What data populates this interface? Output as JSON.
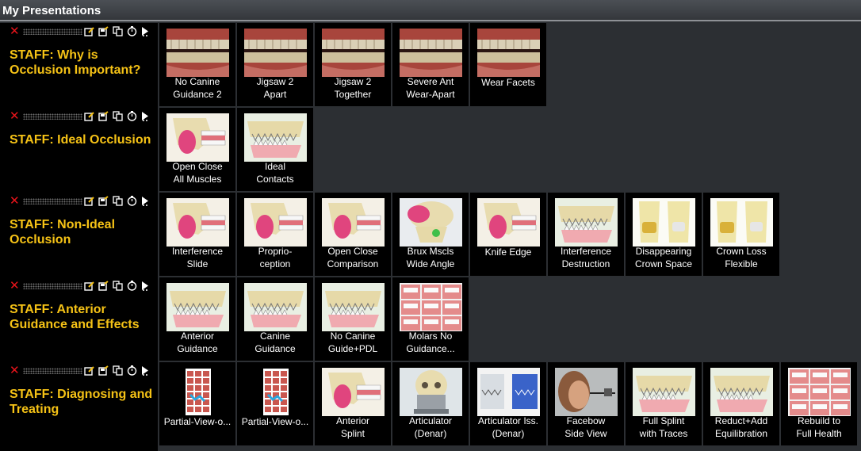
{
  "header": {
    "title": "My Presentations"
  },
  "rows": [
    {
      "title": "STAFF: Why is Occlusion Important?",
      "items": [
        {
          "label": "No Canine\nGuidance 2",
          "icon": "teeth-photo-icon"
        },
        {
          "label": "Jigsaw 2\nApart",
          "icon": "teeth-photo-icon"
        },
        {
          "label": "Jigsaw 2\nTogether",
          "icon": "teeth-photo-icon"
        },
        {
          "label": "Severe Ant\nWear-Apart",
          "icon": "teeth-photo-icon"
        },
        {
          "label": "Wear Facets",
          "icon": "teeth-photo-icon"
        }
      ]
    },
    {
      "title": "STAFF: Ideal Occlusion",
      "items": [
        {
          "label": "Open Close\nAll Muscles",
          "icon": "jaw-muscle-icon"
        },
        {
          "label": "Ideal\nContacts",
          "icon": "jaw-teeth-icon"
        }
      ]
    },
    {
      "title": "STAFF: Non-Ideal Occlusion",
      "items": [
        {
          "label": "Interference\nSlide",
          "icon": "jaw-muscle-icon"
        },
        {
          "label": "Proprio-\nception",
          "icon": "jaw-muscle-icon"
        },
        {
          "label": "Open Close\nComparison",
          "icon": "jaw-muscle-icon"
        },
        {
          "label": "Brux Mscls\nWide Angle",
          "icon": "skull-muscle-icon"
        },
        {
          "label": "Knife Edge",
          "icon": "jaw-muscle-icon"
        },
        {
          "label": "Interference\nDestruction",
          "icon": "jaw-teeth-icon"
        },
        {
          "label": "Disappearing\nCrown Space",
          "icon": "tooth-icon"
        },
        {
          "label": "Crown Loss\nFlexible",
          "icon": "tooth-icon"
        }
      ]
    },
    {
      "title": "STAFF: Anterior Guidance and Effects",
      "items": [
        {
          "label": "Anterior\nGuidance",
          "icon": "jaw-teeth-icon"
        },
        {
          "label": "Canine\nGuidance",
          "icon": "jaw-teeth-icon"
        },
        {
          "label": "No Canine\nGuide+PDL",
          "icon": "jaw-teeth-icon"
        },
        {
          "label": "Molars No\nGuidance...",
          "icon": "grid-icon"
        }
      ]
    },
    {
      "title": "STAFF: Diagnosing and Treating",
      "items": [
        {
          "label": "Partial-View-o...",
          "icon": "document-icon"
        },
        {
          "label": "Partial-View-o...",
          "icon": "document-icon"
        },
        {
          "label": "Anterior\nSplint",
          "icon": "jaw-muscle-icon"
        },
        {
          "label": "Articulator\n(Denar)",
          "icon": "skull-icon"
        },
        {
          "label": "Articulator Iss.\n(Denar)",
          "icon": "articulator-icon"
        },
        {
          "label": "Facebow\nSide View",
          "icon": "face-photo-icon"
        },
        {
          "label": "Full Splint\nwith Traces",
          "icon": "jaw-teeth-icon"
        },
        {
          "label": "Reduct+Add\nEquilibration",
          "icon": "jaw-teeth-icon"
        },
        {
          "label": "Rebuild to\nFull Health",
          "icon": "grid-icon"
        }
      ]
    }
  ],
  "colors": {
    "accent": "#f5c216",
    "delete": "#e8141b",
    "tile_bg": "#000000",
    "panel_bg": "#2c2f33"
  }
}
